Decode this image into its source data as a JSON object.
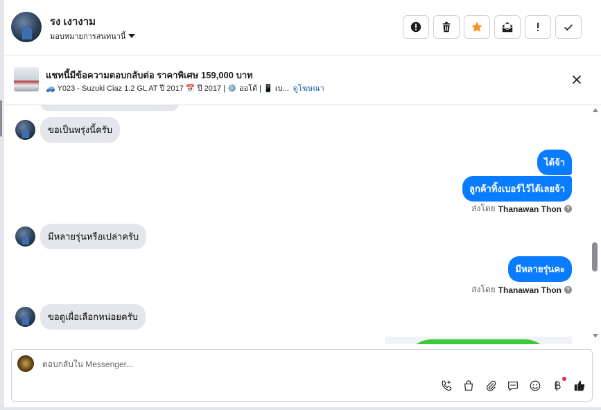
{
  "header": {
    "user_name": "รง เงางาม",
    "assign_label": "มอบหมายการสนทนานี้",
    "actions": [
      {
        "name": "report-button",
        "icon": "exclamation-circle-icon"
      },
      {
        "name": "delete-button",
        "icon": "trash-icon"
      },
      {
        "name": "star-button",
        "icon": "star-icon",
        "color": "#f5922b"
      },
      {
        "name": "mark-unread-button",
        "icon": "envelope-open-icon"
      },
      {
        "name": "spam-button",
        "icon": "exclamation-icon"
      },
      {
        "name": "done-button",
        "icon": "checkmark-icon"
      }
    ]
  },
  "context": {
    "title": "แชทนี้มีข้อความตอบกลับต่อ ราคาพิเศษ 159,000 บาท",
    "subtitle": "🚙 Y023 - Suzuki Ciaz 1.2 GL AT ปี 2017 📅 ปี 2017 | ⚙️ ออโต้ | 📱 เบ...",
    "link": "ดูโฆษณา",
    "close_icon": "close-icon"
  },
  "messages": [
    {
      "direction": "in",
      "text": "ขอเป็นพรุ่งนี้ครับ"
    },
    {
      "direction": "out",
      "text": "ได้จ้า"
    },
    {
      "direction": "out",
      "text": "ลูกค้าทิ้งเบอร์ไว้ได้เลยจ้า"
    },
    {
      "direction": "meta",
      "prefix": "ส่งโดย",
      "sender": "Thanawan Thon"
    },
    {
      "direction": "in",
      "text": "มีหลายรุ่นหรือเปล่าครับ"
    },
    {
      "direction": "out",
      "text": "มีหลายรุ่นคะ"
    },
    {
      "direction": "meta",
      "prefix": "ส่งโดย",
      "sender": "Thanawan Thon"
    },
    {
      "direction": "in",
      "text": "ขอดูเผื่อเลือกหน่อยครับ"
    }
  ],
  "composer": {
    "placeholder": "ตอบกลับใน Messenger...",
    "tools": [
      "phone-plus-icon",
      "shopping-bag-icon",
      "paperclip-icon",
      "chat-bubble-icon",
      "smiley-icon",
      "baht-icon",
      "thumbs-up-icon"
    ]
  },
  "colors": {
    "accent_blue": "#0a7cff",
    "incoming_bubble": "#e4e6eb",
    "star": "#f5922b",
    "link": "#1a5fa8",
    "notification_dot": "#f02849"
  }
}
